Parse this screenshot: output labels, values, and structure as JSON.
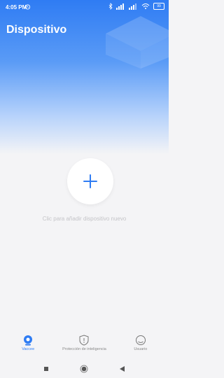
{
  "status_bar": {
    "time": "4:05 PM",
    "battery": "99"
  },
  "header": {
    "title": "Dispositivo"
  },
  "main": {
    "add_hint": "Clic para añadir dispositivo nuevo"
  },
  "bottom_nav": {
    "items": [
      {
        "label": "Vaccee",
        "icon": "camera-icon",
        "active": true
      },
      {
        "label": "Protección de inteligencia",
        "icon": "shield-icon",
        "active": false
      },
      {
        "label": "Usuario",
        "icon": "user-icon",
        "active": false
      }
    ]
  },
  "colors": {
    "accent": "#2f7cf3",
    "background": "#f4f4f6"
  }
}
